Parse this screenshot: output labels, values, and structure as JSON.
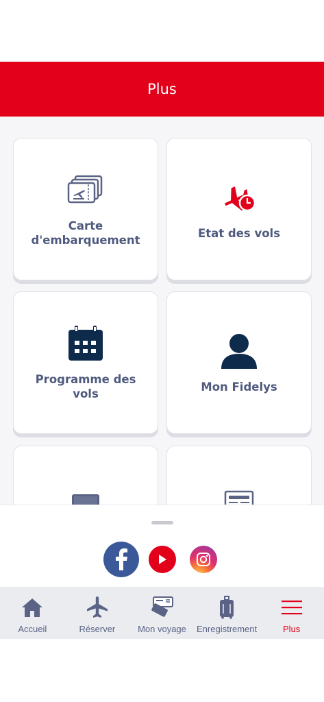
{
  "header": {
    "title": "Plus"
  },
  "tiles": [
    {
      "label_line1": "Carte",
      "label_line2": "d'embarquement",
      "icon": "boarding-pass-icon"
    },
    {
      "label": "Etat des vols",
      "icon": "flight-status-icon"
    },
    {
      "label": "Programme des vols",
      "icon": "calendar-icon"
    },
    {
      "label": "Mon Fidelys",
      "icon": "user-icon"
    },
    {
      "label": "",
      "icon": "laptop-icon"
    },
    {
      "label": "",
      "icon": "newspaper-icon"
    }
  ],
  "social": [
    {
      "name": "facebook",
      "icon": "facebook-icon",
      "color": "#3b5998"
    },
    {
      "name": "youtube",
      "icon": "youtube-icon",
      "color": "#e2001a"
    },
    {
      "name": "instagram",
      "icon": "instagram-icon"
    }
  ],
  "tabs": [
    {
      "label": "Accueil",
      "icon": "home-icon"
    },
    {
      "label": "Réserver",
      "icon": "plane-icon"
    },
    {
      "label": "Mon voyage",
      "icon": "tickets-icon"
    },
    {
      "label": "Enregistrement",
      "icon": "luggage-icon"
    },
    {
      "label": "Plus",
      "icon": "menu-icon",
      "active": true
    }
  ],
  "colors": {
    "brand_red": "#e2001a",
    "navy": "#0f2b4b",
    "label": "#4f5a7e",
    "tab_text": "#5a6385"
  }
}
